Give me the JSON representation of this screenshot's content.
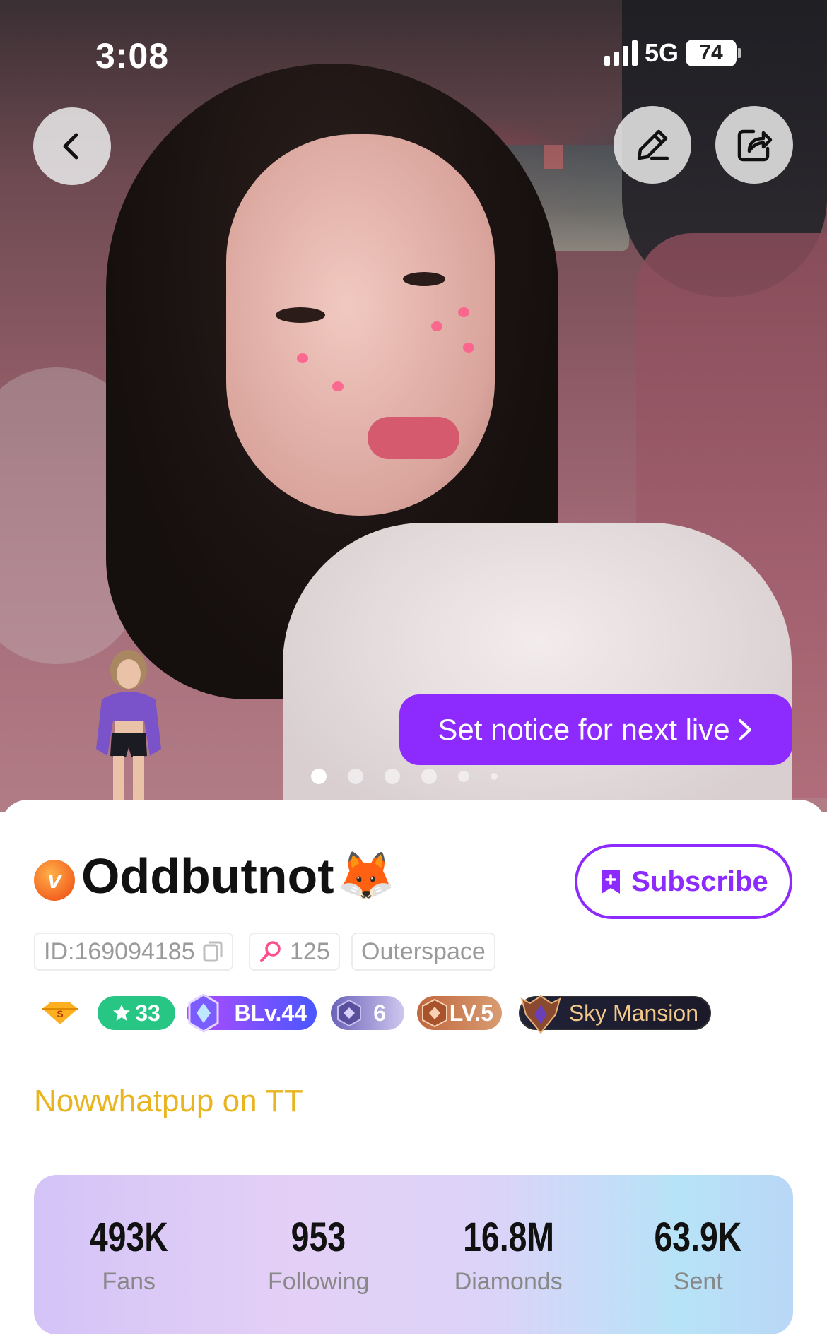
{
  "status_bar": {
    "time": "3:08",
    "network": "5G",
    "battery": "74"
  },
  "hero": {
    "notice_label": "Set notice for next live",
    "page_indicator": {
      "count": 6,
      "active": 0
    }
  },
  "profile": {
    "vip_letter": "v",
    "username": "Oddbutnot",
    "username_emoji": "🦊",
    "subscribe_label": "Subscribe",
    "id_label": "ID:169094185",
    "fan_club_count": "125",
    "location": "Outerspace",
    "bio": "Nowwhatpup on TT"
  },
  "badges": {
    "star_level": "33",
    "blv": "BLv.44",
    "medal": "6",
    "lv": "LV.5",
    "mansion": "Sky Mansion"
  },
  "stats": [
    {
      "value": "493K",
      "label": "Fans"
    },
    {
      "value": "953",
      "label": "Following"
    },
    {
      "value": "16.8M",
      "label": "Diamonds"
    },
    {
      "value": "63.9K",
      "label": "Sent"
    }
  ],
  "colors": {
    "accent_purple": "#8d2bff",
    "bio_yellow": "#e8b520",
    "star_green": "#27c685"
  }
}
